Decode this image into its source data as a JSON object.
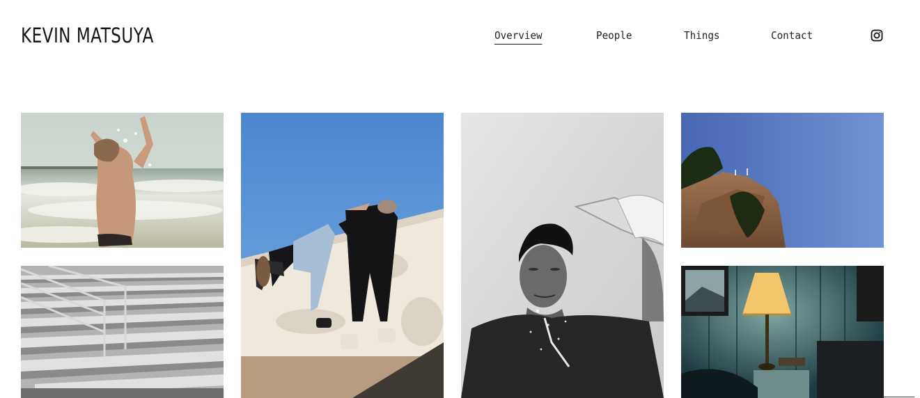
{
  "site": {
    "title": "KEVIN MATSUYA"
  },
  "nav": {
    "items": [
      {
        "label": "Overview",
        "active": true
      },
      {
        "label": "People",
        "active": false
      },
      {
        "label": "Things",
        "active": false
      },
      {
        "label": "Contact",
        "active": false
      }
    ],
    "social_icon": "instagram-icon"
  },
  "gallery": {
    "tiles": [
      {
        "subject": "beach-splash-photo"
      },
      {
        "subject": "two-people-climbing-wall-photo"
      },
      {
        "subject": "water-pour-portrait-photo"
      },
      {
        "subject": "cliff-sky-photo"
      },
      {
        "subject": "bleachers-photo"
      },
      {
        "subject": "bedside-lamp-photo"
      }
    ]
  },
  "colors": {
    "background": "#ffffff",
    "text": "#151515",
    "sky_blue": "#6f9fd6",
    "deep_blue": "#3f68b4"
  }
}
